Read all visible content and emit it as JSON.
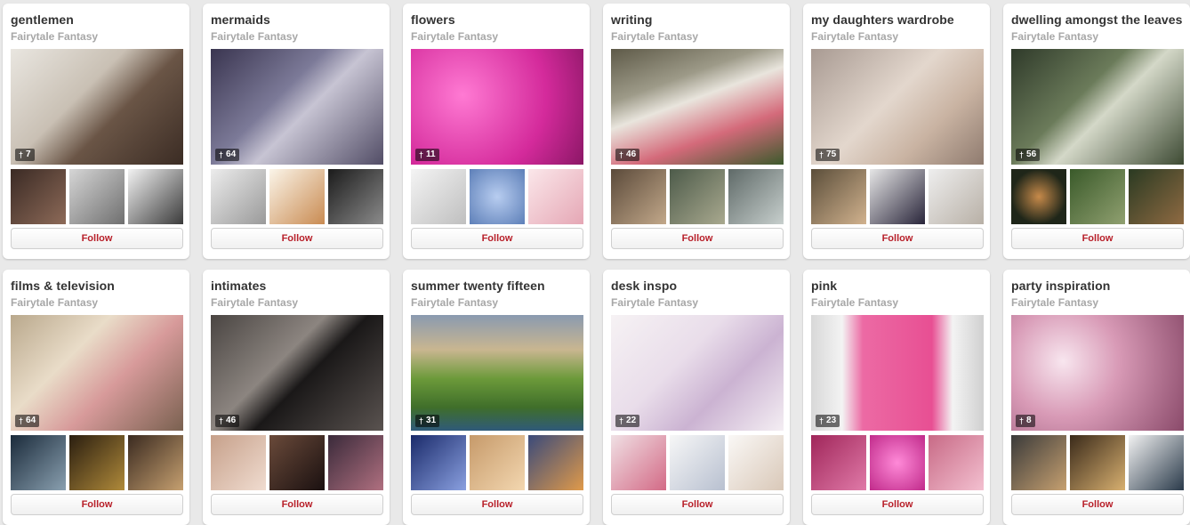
{
  "boards": [
    {
      "title": "gentlemen",
      "owner": "Fairytale Fantasy",
      "pins": "7",
      "follow": "Follow",
      "cover": "linear-gradient(135deg,#e9e6e0 0%,#c9c0b4 40%,#6a5546 60%,#3b2c24 100%)",
      "thumbs": [
        "linear-gradient(135deg,#3a2a24,#8d6a58)",
        "linear-gradient(135deg,#d6d6d6,#6f6f6f)",
        "linear-gradient(135deg,#f2f2f2,#3b3b3b)"
      ]
    },
    {
      "title": "mermaids",
      "owner": "Fairytale Fantasy",
      "pins": "64",
      "follow": "Follow",
      "cover": "linear-gradient(135deg,#3a3550 0%,#7c7a98 40%,#c7c4d3 55%,#524d66 100%)",
      "thumbs": [
        "linear-gradient(135deg,#ececec,#9a9a9a)",
        "linear-gradient(135deg,#fbf5e9,#c98b52)",
        "linear-gradient(135deg,#1b1b1b,#8b8b8b)"
      ]
    },
    {
      "title": "flowers",
      "owner": "Fairytale Fantasy",
      "pins": "11",
      "follow": "Follow",
      "cover": "radial-gradient(circle at 30% 40%,#ff7ad3,#d42a9b 60%,#8b1766 100%)",
      "thumbs": [
        "linear-gradient(135deg,#f4f4f4,#bfbfbf)",
        "radial-gradient(circle,#b8cdf0,#5d7fb8)",
        "linear-gradient(135deg,#fbe7ea,#e5a7b5)"
      ]
    },
    {
      "title": "writing",
      "owner": "Fairytale Fantasy",
      "pins": "46",
      "follow": "Follow",
      "cover": "linear-gradient(160deg,#5e5a48 0%,#9d9a88 30%,#e9e5dd 45%,#d46a7a 70%,#3c5a2c 100%)",
      "thumbs": [
        "linear-gradient(135deg,#5b4a3a,#c2a88a)",
        "linear-gradient(135deg,#4d5b4a,#a9a98f)",
        "linear-gradient(135deg,#5f6a68,#c7cfcd)"
      ]
    },
    {
      "title": "my daughters wardrobe",
      "owner": "Fairytale Fantasy",
      "pins": "75",
      "follow": "Follow",
      "cover": "linear-gradient(135deg,#a89a92 0%,#e3d7cd 45%,#c9b3a2 70%,#8f7b6f 100%)",
      "thumbs": [
        "linear-gradient(135deg,#5b4e3a,#d1b28e)",
        "linear-gradient(135deg,#e6e6e6,#29253a)",
        "linear-gradient(135deg,#eeeeee,#b8b0a6)"
      ]
    },
    {
      "title": "dwelling amongst the leaves",
      "owner": "Fairytale Fantasy",
      "pins": "56",
      "follow": "Follow",
      "cover": "linear-gradient(135deg,#2f3a2a 0%,#6b7b5a 40%,#d4d8c8 55%,#3d4a33 100%)",
      "thumbs": [
        "radial-gradient(circle,#c78a4a,#1f2619 70%)",
        "linear-gradient(135deg,#3a5a2a,#90a070)",
        "linear-gradient(135deg,#2a3a22,#8f6a42)"
      ]
    },
    {
      "title": "films & television",
      "owner": "Fairytale Fantasy",
      "pins": "64",
      "follow": "Follow",
      "cover": "linear-gradient(135deg,#b9a88c 0%,#e9dcc8 35%,#d79a9a 60%,#7a6150 100%)",
      "thumbs": [
        "linear-gradient(135deg,#1a2a3a,#8aa0b0)",
        "linear-gradient(135deg,#2a1e10,#b08a3a)",
        "linear-gradient(135deg,#3a2a20,#c6a070)"
      ]
    },
    {
      "title": "intimates",
      "owner": "Fairytale Fantasy",
      "pins": "46",
      "follow": "Follow",
      "cover": "linear-gradient(135deg,#4a4542 0%,#8c8580 40%,#1a1818 55%,#5a5350 100%)",
      "thumbs": [
        "linear-gradient(135deg,#c6a08a,#f0dcd0)",
        "linear-gradient(135deg,#6a4a3a,#1a1010)",
        "linear-gradient(135deg,#3a2a3a,#b07080)"
      ]
    },
    {
      "title": "summer twenty fifteen",
      "owner": "Fairytale Fantasy",
      "pins": "31",
      "follow": "Follow",
      "cover": "linear-gradient(180deg,#8a9ab0 0%,#c9b690 30%,#6c9a3a 55%,#3f6e2a 80%,#2f5a7a 100%)",
      "thumbs": [
        "linear-gradient(135deg,#1a2a6a,#8aa0e0)",
        "linear-gradient(135deg,#c69a6a,#f3d7b0)",
        "linear-gradient(135deg,#3a4a7a,#e09a4a)"
      ]
    },
    {
      "title": "desk inspo",
      "owner": "Fairytale Fantasy",
      "pins": "22",
      "follow": "Follow",
      "cover": "linear-gradient(135deg,#f6f2f4 0%,#e9ddea 40%,#cbb3d2 65%,#f4eef3 100%)",
      "thumbs": [
        "linear-gradient(135deg,#f0e0e4,#d36a86)",
        "linear-gradient(135deg,#f7f7f7,#b8c0d0)",
        "linear-gradient(135deg,#faf8f6,#d9c8b8)"
      ]
    },
    {
      "title": "pink",
      "owner": "Fairytale Fantasy",
      "pins": "23",
      "follow": "Follow",
      "cover": "linear-gradient(90deg,#d8d8d8 0%,#f3f3f3 18%,#ec6aa4 30%,#e84f93 70%,#f3f3f3 82%,#d0d0d0 100%)",
      "thumbs": [
        "linear-gradient(135deg,#a0265a,#e07aa8)",
        "radial-gradient(circle,#ff8ad8,#c02a8a)",
        "linear-gradient(135deg,#c86a86,#f3c0d0)"
      ]
    },
    {
      "title": "party inspiration",
      "owner": "Fairytale Fantasy",
      "pins": "8",
      "follow": "Follow",
      "cover": "radial-gradient(circle at 30% 40%,#f8e6ef,#d89ab6 40%,#8a4a6a 100%)",
      "thumbs": [
        "linear-gradient(135deg,#3a3a3a,#c6a070)",
        "linear-gradient(135deg,#3a2a1a,#d8b070)",
        "linear-gradient(135deg,#f2f2f2,#2a3a4a)"
      ]
    }
  ]
}
